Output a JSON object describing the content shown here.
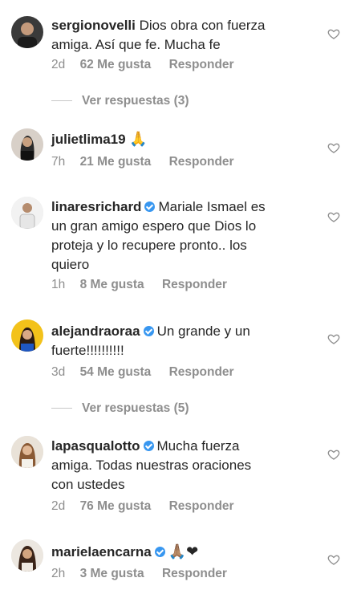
{
  "comments": [
    {
      "username": "sergionovelli",
      "verified": false,
      "text_lines": [
        "Dios obra con fuerza",
        "amiga. Así que fe. Mucha fe"
      ],
      "time": "2d",
      "likes": "62 Me gusta",
      "reply": "Responder",
      "view_replies": "Ver respuestas (3)"
    },
    {
      "username": "julietlima19",
      "verified": false,
      "text_lines": [
        "🙏"
      ],
      "time": "7h",
      "likes": "21 Me gusta",
      "reply": "Responder"
    },
    {
      "username": "linaresrichard",
      "verified": true,
      "text_lines": [
        "Mariale Ismael es",
        "un gran amigo espero que Dios lo",
        "proteja y lo recupere pronto.. los",
        "quiero"
      ],
      "time": "1h",
      "likes": "8 Me gusta",
      "reply": "Responder"
    },
    {
      "username": "alejandraoraa",
      "verified": true,
      "text_lines": [
        "Un grande y un",
        "fuerte!!!!!!!!!!"
      ],
      "time": "3d",
      "likes": "54 Me gusta",
      "reply": "Responder",
      "view_replies": "Ver respuestas (5)"
    },
    {
      "username": "lapasqualotto",
      "verified": true,
      "text_lines": [
        "Mucha fuerza",
        "amiga.  Todas nuestras oraciones",
        "con ustedes"
      ],
      "time": "2d",
      "likes": "76 Me gusta",
      "reply": "Responder"
    },
    {
      "username": "marielaencarna",
      "verified": true,
      "text_lines": [
        "🙏🏽❤"
      ],
      "time": "2h",
      "likes": "3 Me gusta",
      "reply": "Responder"
    }
  ],
  "icons": {
    "like": "heart-outline-icon",
    "verified": "verified-badge-icon"
  },
  "colors": {
    "verified_blue": "#3897f0",
    "meta_gray": "#8e8e8e",
    "text": "#262626"
  }
}
